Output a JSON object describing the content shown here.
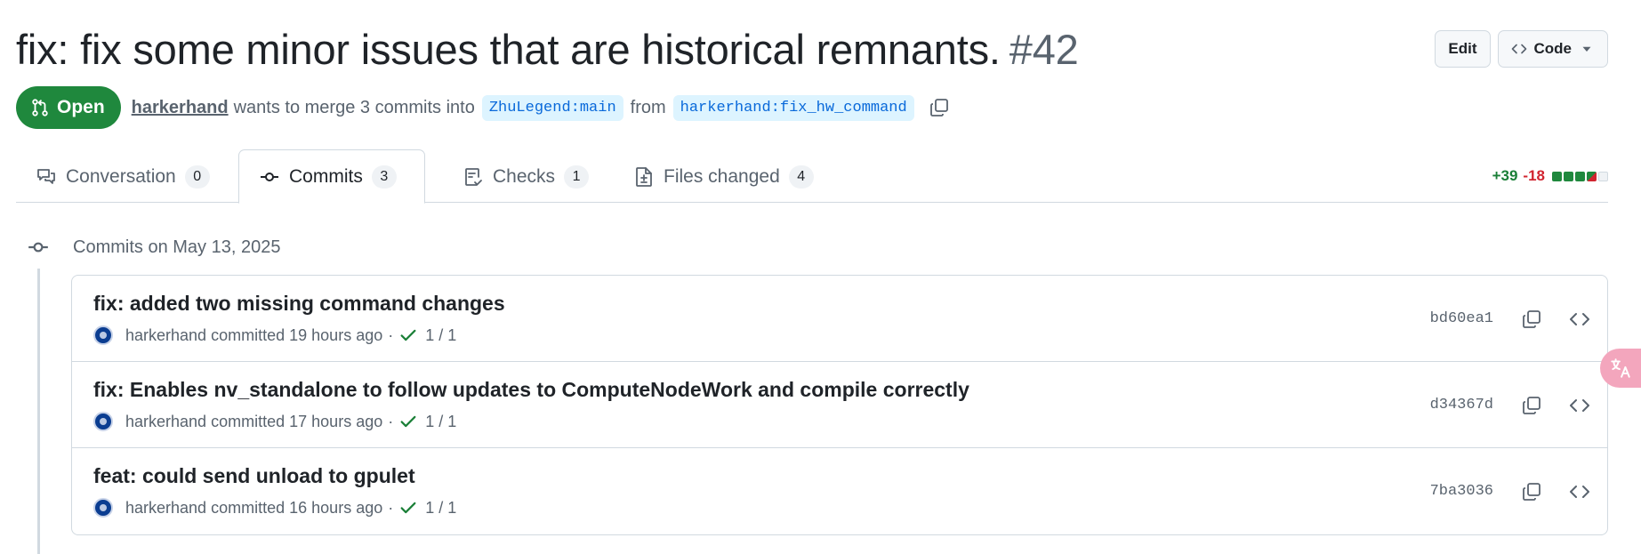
{
  "header": {
    "title": "fix: fix some minor issues that are historical remnants.",
    "number": "#42",
    "edit_label": "Edit",
    "code_label": "Code"
  },
  "meta": {
    "state": "Open",
    "author": "harkerhand",
    "text_merge": "wants to merge 3 commits into",
    "base_branch": "ZhuLegend:main",
    "text_from": "from",
    "head_branch": "harkerhand:fix_hw_command"
  },
  "tabs": [
    {
      "label": "Conversation",
      "count": "0",
      "icon": "comment-discussion-icon"
    },
    {
      "label": "Commits",
      "count": "3",
      "icon": "git-commit-icon",
      "active": true
    },
    {
      "label": "Checks",
      "count": "1",
      "icon": "checklist-icon"
    },
    {
      "label": "Files changed",
      "count": "4",
      "icon": "file-diff-icon"
    }
  ],
  "diffstat": {
    "additions": "+39",
    "deletions": "-18",
    "blocks": [
      "add",
      "add",
      "add",
      "mixed",
      "neutral"
    ]
  },
  "timeline": {
    "day_label": "Commits on May 13, 2025"
  },
  "commits": [
    {
      "title": "fix: added two missing command changes",
      "author": "harkerhand",
      "action": "committed",
      "time": "19 hours ago",
      "checks": "1 / 1",
      "sha": "bd60ea1"
    },
    {
      "title": "fix: Enables nv_standalone to follow updates to ComputeNodeWork and compile correctly",
      "author": "harkerhand",
      "action": "committed",
      "time": "17 hours ago",
      "checks": "1 / 1",
      "sha": "d34367d"
    },
    {
      "title": "feat: could send unload to gpulet",
      "author": "harkerhand",
      "action": "committed",
      "time": "16 hours ago",
      "checks": "1 / 1",
      "sha": "7ba3036"
    }
  ],
  "colors": {
    "open_green": "#1f883d",
    "add_green": "#1a7f37",
    "del_red": "#d1242f",
    "branch_bg": "#ddf4ff",
    "branch_fg": "#0969da"
  }
}
